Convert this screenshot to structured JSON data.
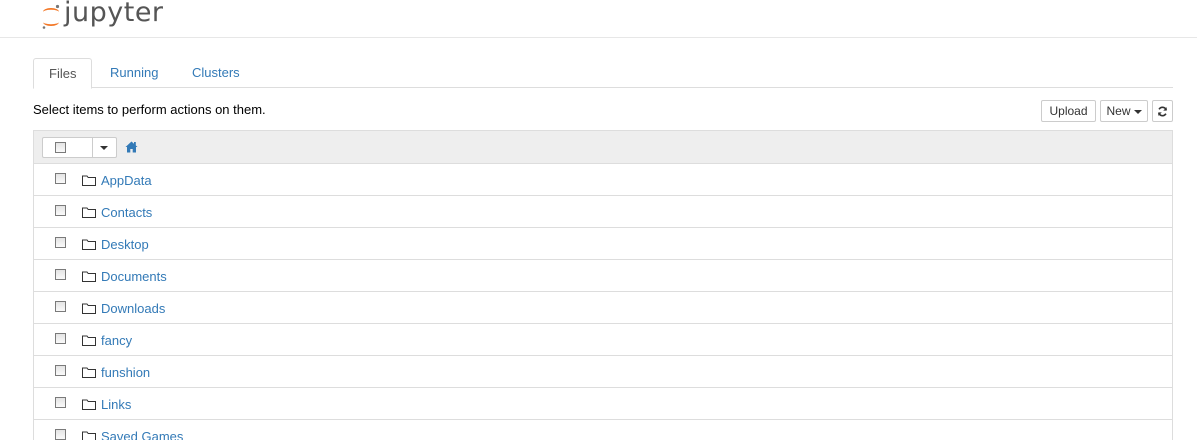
{
  "header": {
    "logo_text": "jupyter"
  },
  "tabs": [
    {
      "label": "Files",
      "active": true
    },
    {
      "label": "Running",
      "active": false
    },
    {
      "label": "Clusters",
      "active": false
    }
  ],
  "toolbar": {
    "hint": "Select items to perform actions on them.",
    "upload_label": "Upload",
    "new_label": "New"
  },
  "files": [
    {
      "name": "AppData",
      "type": "folder"
    },
    {
      "name": "Contacts",
      "type": "folder"
    },
    {
      "name": "Desktop",
      "type": "folder"
    },
    {
      "name": "Documents",
      "type": "folder"
    },
    {
      "name": "Downloads",
      "type": "folder"
    },
    {
      "name": "fancy",
      "type": "folder"
    },
    {
      "name": "funshion",
      "type": "folder"
    },
    {
      "name": "Links",
      "type": "folder"
    },
    {
      "name": "Saved Games",
      "type": "folder"
    }
  ],
  "colors": {
    "link": "#337ab7",
    "logo_orange": "#f37726",
    "header_bg": "#eeeeee"
  }
}
